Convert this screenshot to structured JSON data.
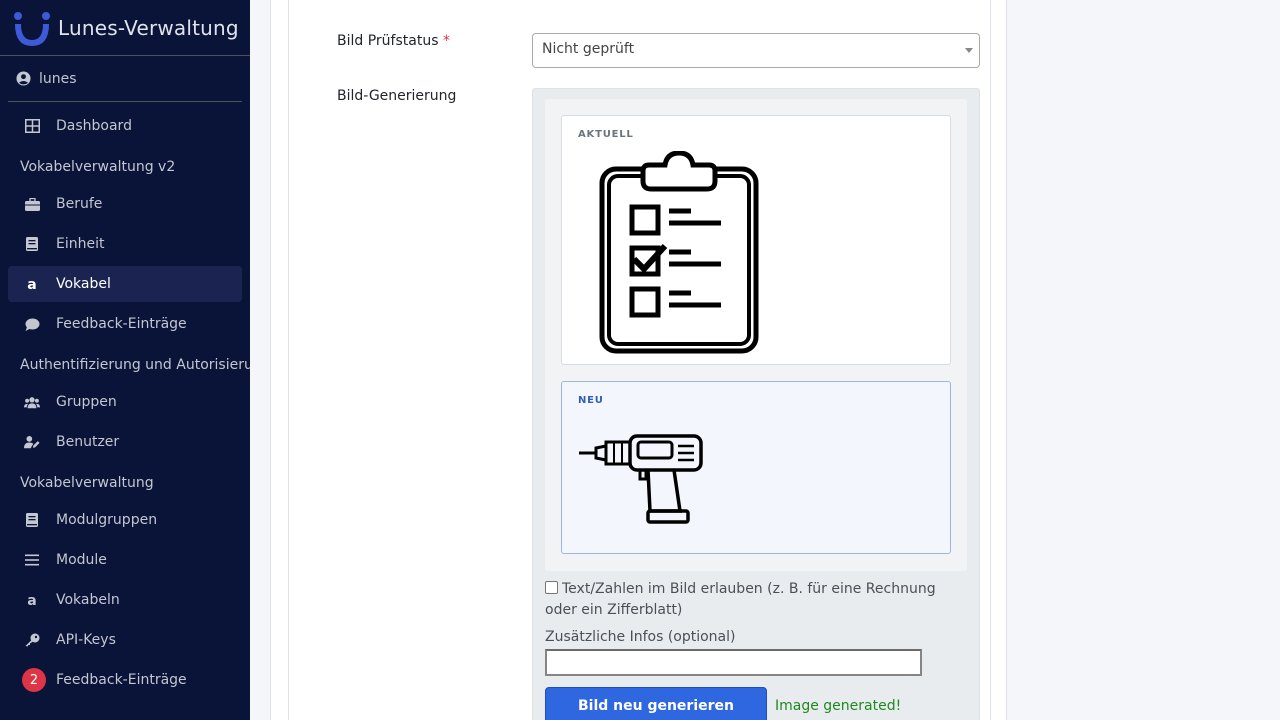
{
  "brand": {
    "title": "Lunes-Verwaltung"
  },
  "user": {
    "name": "lunes"
  },
  "sidebar": {
    "items": [
      {
        "type": "item",
        "label": "Dashboard",
        "icon": "dashboard-icon"
      },
      {
        "type": "header",
        "label": "Vokabelverwaltung v2"
      },
      {
        "type": "item",
        "label": "Berufe",
        "icon": "briefcase-icon"
      },
      {
        "type": "item",
        "label": "Einheit",
        "icon": "book-icon"
      },
      {
        "type": "item",
        "label": "Vokabel",
        "icon": "letter-a-icon",
        "active": true
      },
      {
        "type": "item",
        "label": "Feedback-Einträge",
        "icon": "comment-icon"
      },
      {
        "type": "header",
        "label": "Authentifizierung und Autorisierung"
      },
      {
        "type": "item",
        "label": "Gruppen",
        "icon": "users-icon"
      },
      {
        "type": "item",
        "label": "Benutzer",
        "icon": "user-edit-icon"
      },
      {
        "type": "header",
        "label": "Vokabelverwaltung"
      },
      {
        "type": "item",
        "label": "Modulgruppen",
        "icon": "book-icon"
      },
      {
        "type": "item",
        "label": "Module",
        "icon": "list-icon"
      },
      {
        "type": "item",
        "label": "Vokabeln",
        "icon": "letter-a-icon"
      },
      {
        "type": "item",
        "label": "API-Keys",
        "icon": "key-icon"
      },
      {
        "type": "item",
        "label": "Feedback-Einträge",
        "icon": "badge",
        "badge": "2"
      }
    ]
  },
  "form": {
    "pruefstatus_label": "Bild Prüfstatus",
    "required_mark": "*",
    "pruefstatus_value": "Nicht geprüft",
    "generation_label": "Bild-Generierung",
    "current_label": "AKTUELL",
    "new_label": "NEU",
    "current_image_icon": "clipboard-checklist-icon",
    "new_image_icon": "power-drill-icon",
    "allow_text_label": "Text/Zahlen im Bild erlauben (z. B. für eine Rechnung oder ein Zifferblatt)",
    "extra_info_label": "Zusätzliche Infos (optional)",
    "extra_info_value": "",
    "regenerate_button": "Bild neu generieren",
    "status_text": "Image generated!"
  },
  "colors": {
    "sidebar_bg": "#0a1338",
    "active_item_bg": "#1b2451",
    "primary_button": "#2f67e0",
    "success_text": "#1e8a1e",
    "badge": "#dc3545"
  }
}
